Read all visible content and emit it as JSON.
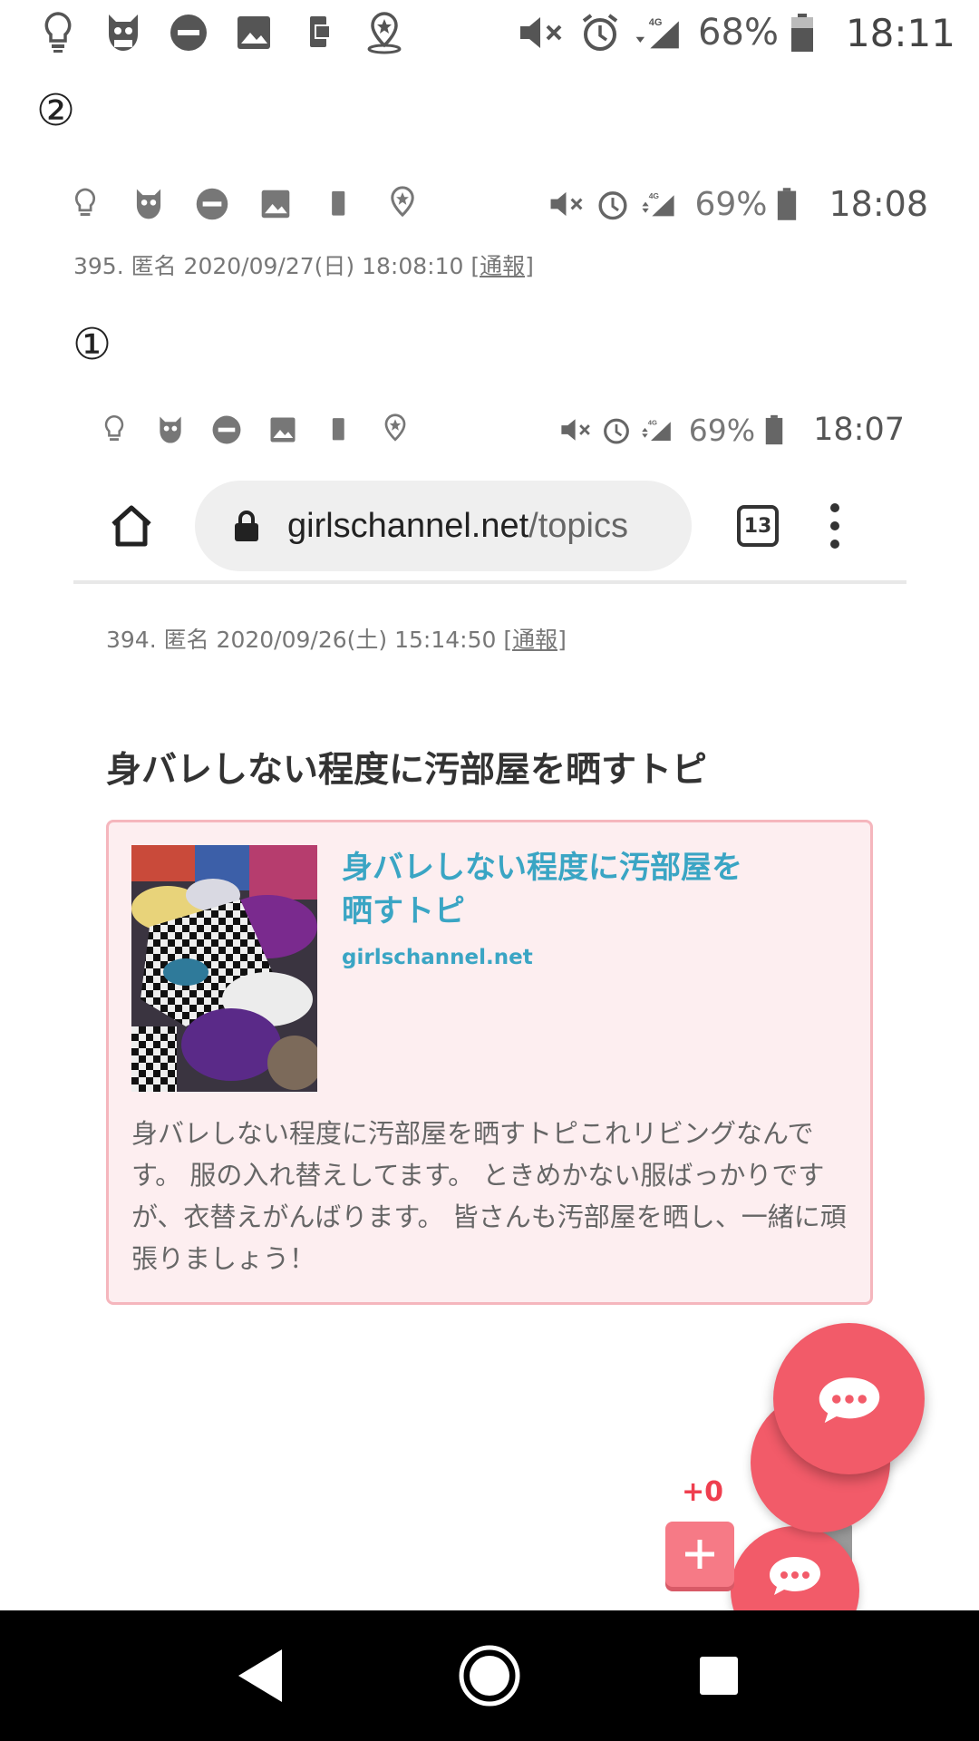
{
  "status_top": {
    "battery_pct": "68%",
    "time": "18:11",
    "network": "4G"
  },
  "marker_2": "②",
  "status_2": {
    "battery_pct": "69%",
    "time": "18:08",
    "network": "4G"
  },
  "comment_395": {
    "meta": "395. 匿名 2020/09/27(日) 18:08:10 ",
    "report": "[通報]"
  },
  "marker_1": "①",
  "status_1": {
    "battery_pct": "69%",
    "time": "18:07",
    "network": "4G"
  },
  "browser": {
    "url_host": "girlschannel.net",
    "url_path": "/topics",
    "tab_count": "13"
  },
  "comment_394": {
    "meta": "394. 匿名 2020/09/26(土) 15:14:50 ",
    "report": "[通報]"
  },
  "topic": {
    "title": "身バレしない程度に汚部屋を晒すトピ",
    "card_title": "身バレしない程度に汚部屋を晒すトピ",
    "card_domain": "girlschannel.net",
    "card_description": "身バレしない程度に汚部屋を晒すトピこれリビングなんです。 服の入れ替えしてます。 ときめかない服ばっかりですが、衣替えがんばります。 皆さんも汚部屋を晒し、一緒に頑張りましょう！"
  },
  "plus_count": "+0",
  "colors": {
    "accent": "#f25b69",
    "link": "#3aa5c4",
    "card_bg": "#fdeef0",
    "card_border": "#f5b6bd"
  },
  "icons": [
    "lightbulb-icon",
    "cat-avatar-icon",
    "do-not-disturb-icon",
    "image-icon",
    "phone-cast-icon",
    "location-star-icon",
    "mute-icon",
    "alarm-icon",
    "signal-icon",
    "battery-icon"
  ]
}
